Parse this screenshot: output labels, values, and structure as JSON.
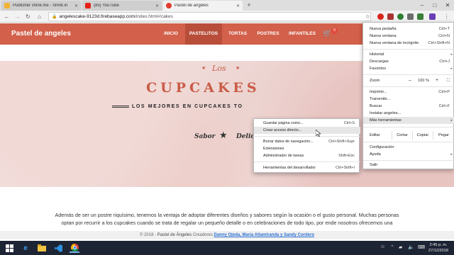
{
  "browser": {
    "tabs": [
      {
        "title": "Publisher shink.me - Shink.in",
        "icon": "shink-favicon-icon",
        "color": "#f2b233",
        "active": false
      },
      {
        "title": "(85) YouTube",
        "icon": "youtube-favicon-icon",
        "color": "#e62117",
        "active": false
      },
      {
        "title": "Pastel de angeles",
        "icon": "site-favicon-icon",
        "color": "#e03b2f",
        "active": true
      }
    ],
    "address": {
      "host": "angelescake-9123d.firebaseapp.com",
      "path": "/index.html#/cakes"
    }
  },
  "site": {
    "brand": "Pastel de angeles",
    "nav": [
      "INICIO",
      "PASTELITOS",
      "TORTAS",
      "POSTRES",
      "INFANTILES"
    ],
    "active_nav": "PASTELITOS",
    "cart_count": "0",
    "hero": {
      "script_title": "Los",
      "title": "CUPCAKES",
      "tagline": "LOS MEJORES EN CUPCAKES TO",
      "sabor": "Sabor",
      "delicia": "Delici"
    },
    "paragraph_1": "Además de ser un postre riquísimo, tenemos la ventaja de adoptar diferentes diseños y sabores según la ocasión o el gusto personal. Muchas personas",
    "paragraph_2": "optan por recurrir a los cupcakes cuando se trata de regalar un pequeño detalle o en celebraciones de todo tipo, por ende nosotros ofrecemos una",
    "footer": {
      "prefix": "© 2018 - ",
      "site": "Pastel de Ángeles",
      "creators_label": " Creadores ",
      "creators": "Danny Ojeda, María Altamiranda y Sandy Cordero"
    },
    "colors": {
      "brand": "#d2604a",
      "accent": "#c95c47"
    }
  },
  "chrome_menu": {
    "items_top": [
      {
        "label": "Nueva pestaña",
        "shortcut": "Ctrl+T"
      },
      {
        "label": "Nueva ventana",
        "shortcut": "Ctrl+N"
      },
      {
        "label": "Nueva ventana de incógnito",
        "shortcut": "Ctrl+Shift+N"
      }
    ],
    "items_history": [
      {
        "label": "Historial",
        "arrow": "▸"
      },
      {
        "label": "Descargas",
        "shortcut": "Ctrl+J"
      },
      {
        "label": "Favoritos",
        "arrow": "▸"
      }
    ],
    "zoom": {
      "label": "Zoom",
      "minus": "–",
      "value": "100 %",
      "plus": "+"
    },
    "items_tools": [
      {
        "label": "Imprimir...",
        "shortcut": "Ctrl+P"
      },
      {
        "label": "Transmitir..."
      },
      {
        "label": "Buscar",
        "shortcut": "Ctrl+F"
      },
      {
        "label": "Instalar angeles..."
      },
      {
        "label": "Más herramientas",
        "arrow": "▸"
      }
    ],
    "edit": {
      "label": "Editar",
      "cut": "Cortar",
      "copy": "Copiar",
      "paste": "Pegar"
    },
    "items_bottom": [
      {
        "label": "Configuración"
      },
      {
        "label": "Ayuda",
        "arrow": "▸"
      }
    ],
    "exit": "Salir"
  },
  "submenu": {
    "group_1": [
      {
        "label": "Guardar página como...",
        "shortcut": "Ctrl+S"
      },
      {
        "label": "Crear acceso directo..."
      }
    ],
    "group_2": [
      {
        "label": "Borrar datos de navegación...",
        "shortcut": "Ctrl+Shift+Supr"
      },
      {
        "label": "Extensiones"
      },
      {
        "label": "Administrador de tareas",
        "shortcut": "Shift+Esc"
      }
    ],
    "group_3": [
      {
        "label": "Herramientas del desarrollador",
        "shortcut": "Ctrl+Shift+I"
      }
    ]
  },
  "taskbar": {
    "time": "2:45 p. m.",
    "date": "27/12/2018",
    "apps": [
      "windows-start-icon",
      "internet-explorer-icon",
      "file-explorer-icon",
      "vscode-icon",
      "chrome-icon"
    ]
  }
}
